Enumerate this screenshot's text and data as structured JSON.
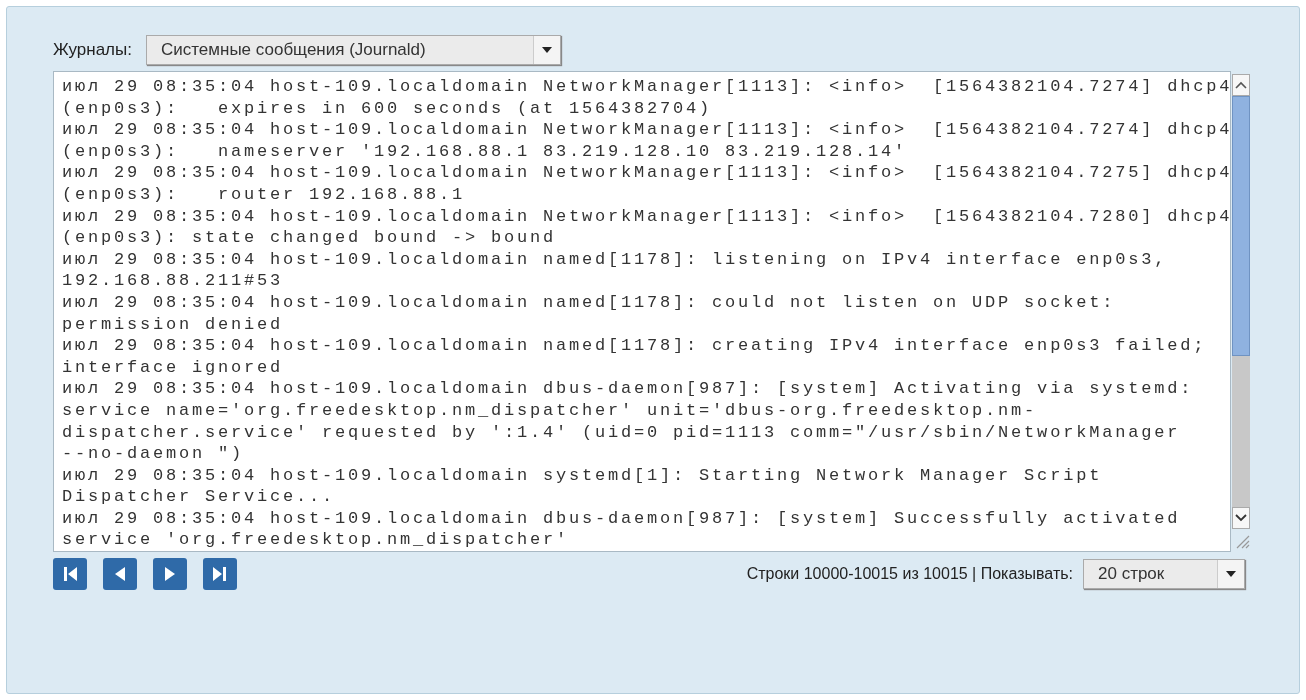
{
  "journal": {
    "label": "Журналы:",
    "value": "Системные сообщения (Journald)"
  },
  "log_lines": [
    "июл 29 08:35:04 host-109.localdomain NetworkManager[1113]: <info>  [1564382104.7274] dhcp4",
    "(enp0s3):   expires in 600 seconds (at 1564382704)",
    "июл 29 08:35:04 host-109.localdomain NetworkManager[1113]: <info>  [1564382104.7274] dhcp4",
    "(enp0s3):   nameserver '192.168.88.1 83.219.128.10 83.219.128.14'",
    "июл 29 08:35:04 host-109.localdomain NetworkManager[1113]: <info>  [1564382104.7275] dhcp4",
    "(enp0s3):   router 192.168.88.1",
    "июл 29 08:35:04 host-109.localdomain NetworkManager[1113]: <info>  [1564382104.7280] dhcp4",
    "(enp0s3): state changed bound -> bound",
    "июл 29 08:35:04 host-109.localdomain named[1178]: listening on IPv4 interface enp0s3,",
    "192.168.88.211#53",
    "июл 29 08:35:04 host-109.localdomain named[1178]: could not listen on UDP socket:",
    "permission denied",
    "июл 29 08:35:04 host-109.localdomain named[1178]: creating IPv4 interface enp0s3 failed;",
    "interface ignored",
    "июл 29 08:35:04 host-109.localdomain dbus-daemon[987]: [system] Activating via systemd:",
    "service name='org.freedesktop.nm_dispatcher' unit='dbus-org.freedesktop.nm-",
    "dispatcher.service' requested by ':1.4' (uid=0 pid=1113 comm=\"/usr/sbin/NetworkManager",
    "--no-daemon \")",
    "июл 29 08:35:04 host-109.localdomain systemd[1]: Starting Network Manager Script",
    "Dispatcher Service...",
    "июл 29 08:35:04 host-109.localdomain dbus-daemon[987]: [system] Successfully activated",
    "service 'org.freedesktop.nm_dispatcher'"
  ],
  "pager": {
    "buttons": [
      {
        "kind": "first"
      },
      {
        "kind": "prev"
      },
      {
        "kind": "next"
      },
      {
        "kind": "last"
      }
    ],
    "range": "Строки 10000-10015 из 10015 | Показывать:",
    "page_size": "20 строк"
  }
}
